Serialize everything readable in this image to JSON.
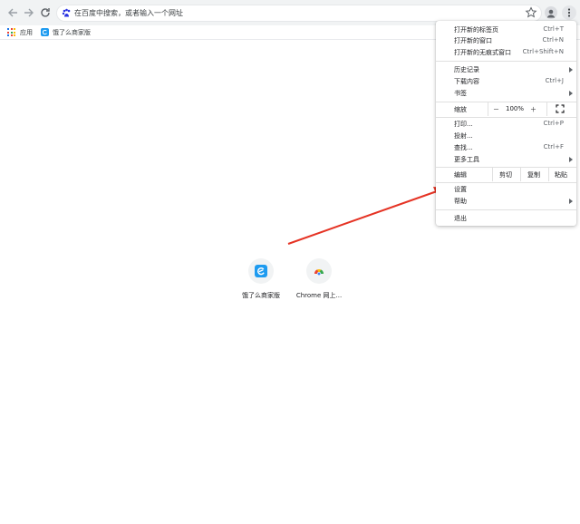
{
  "toolbar": {
    "back_icon": "arrow-left-icon",
    "forward_icon": "arrow-right-icon",
    "reload_icon": "reload-icon",
    "search_engine_icon": "baidu-paw-icon",
    "omnibox_placeholder": "在百度中搜索，或者输入一个网址",
    "bookmark_icon": "star-icon",
    "profile_icon": "person-icon",
    "menu_icon": "three-dots-vertical-icon"
  },
  "bookmarks_bar": {
    "apps_label": "应用",
    "items": [
      {
        "label": "饿了么商家版",
        "icon": "eleme-icon"
      }
    ]
  },
  "new_tab": {
    "shortcuts": [
      {
        "label": "饿了么商家版",
        "icon": "eleme-icon"
      },
      {
        "label": "Chrome 网上...",
        "icon": "chrome-web-store-icon"
      }
    ]
  },
  "menu": {
    "group1": [
      {
        "label": "打开新的标签页",
        "shortcut": "Ctrl+T"
      },
      {
        "label": "打开新的窗口",
        "shortcut": "Ctrl+N"
      },
      {
        "label": "打开新的无痕式窗口",
        "shortcut": "Ctrl+Shift+N"
      }
    ],
    "group2": [
      {
        "label": "历史记录",
        "submenu": true
      },
      {
        "label": "下载内容",
        "shortcut": "Ctrl+J"
      },
      {
        "label": "书签",
        "submenu": true
      }
    ],
    "zoom": {
      "label": "缩放",
      "minus": "－",
      "value": "100%",
      "plus": "＋",
      "fullscreen_icon": "fullscreen-icon"
    },
    "group3": [
      {
        "label": "打印...",
        "shortcut": "Ctrl+P"
      },
      {
        "label": "投射..."
      },
      {
        "label": "查找...",
        "shortcut": "Ctrl+F"
      },
      {
        "label": "更多工具",
        "submenu": true
      }
    ],
    "edit": {
      "label": "编辑",
      "cut": "剪切",
      "copy": "复制",
      "paste": "粘贴"
    },
    "group4": [
      {
        "label": "设置"
      },
      {
        "label": "帮助",
        "submenu": true
      }
    ],
    "exit": {
      "label": "退出"
    }
  },
  "colors": {
    "annotation_arrow": "#e53324",
    "toolbar_bg": "#f1f3f4",
    "eleme_blue": "#1e9bf0"
  }
}
